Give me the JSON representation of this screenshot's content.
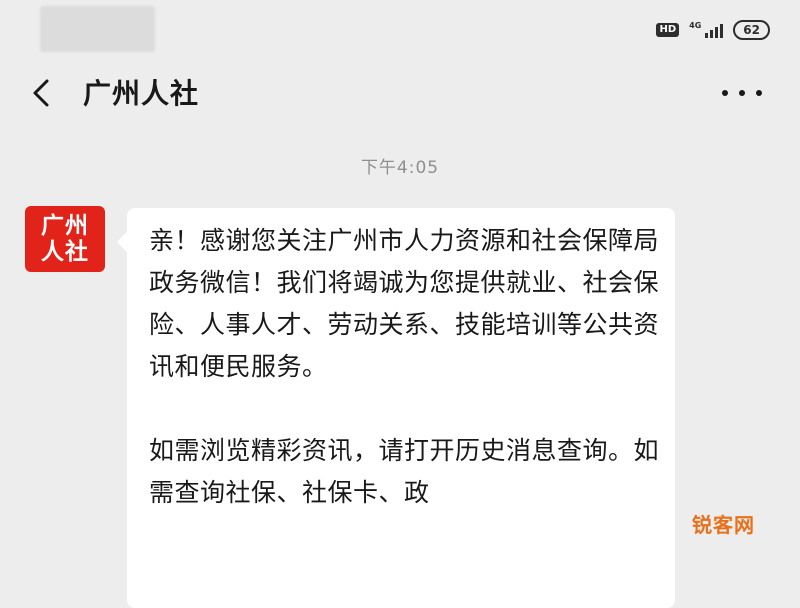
{
  "status_bar": {
    "hd": "HD",
    "network": "4G",
    "battery": "62"
  },
  "nav": {
    "title": "广州人社"
  },
  "chat": {
    "timestamp": "下午4:05",
    "avatar_line1": "广州",
    "avatar_line2": "人社",
    "message": "亲！感谢您关注广州市人力资源和社会保障局政务微信！我们将竭诚为您提供就业、社会保险、人事人才、劳动关系、技能培训等公共资讯和便民服务。\n\n如需浏览精彩资讯，请打开历史消息查询。如需查询社保、社保卡、政"
  },
  "watermark": "锐客网",
  "colors": {
    "avatar_bg": "#e2231a",
    "background": "#ededed",
    "bubble": "#ffffff",
    "watermark": "#e8711c"
  }
}
